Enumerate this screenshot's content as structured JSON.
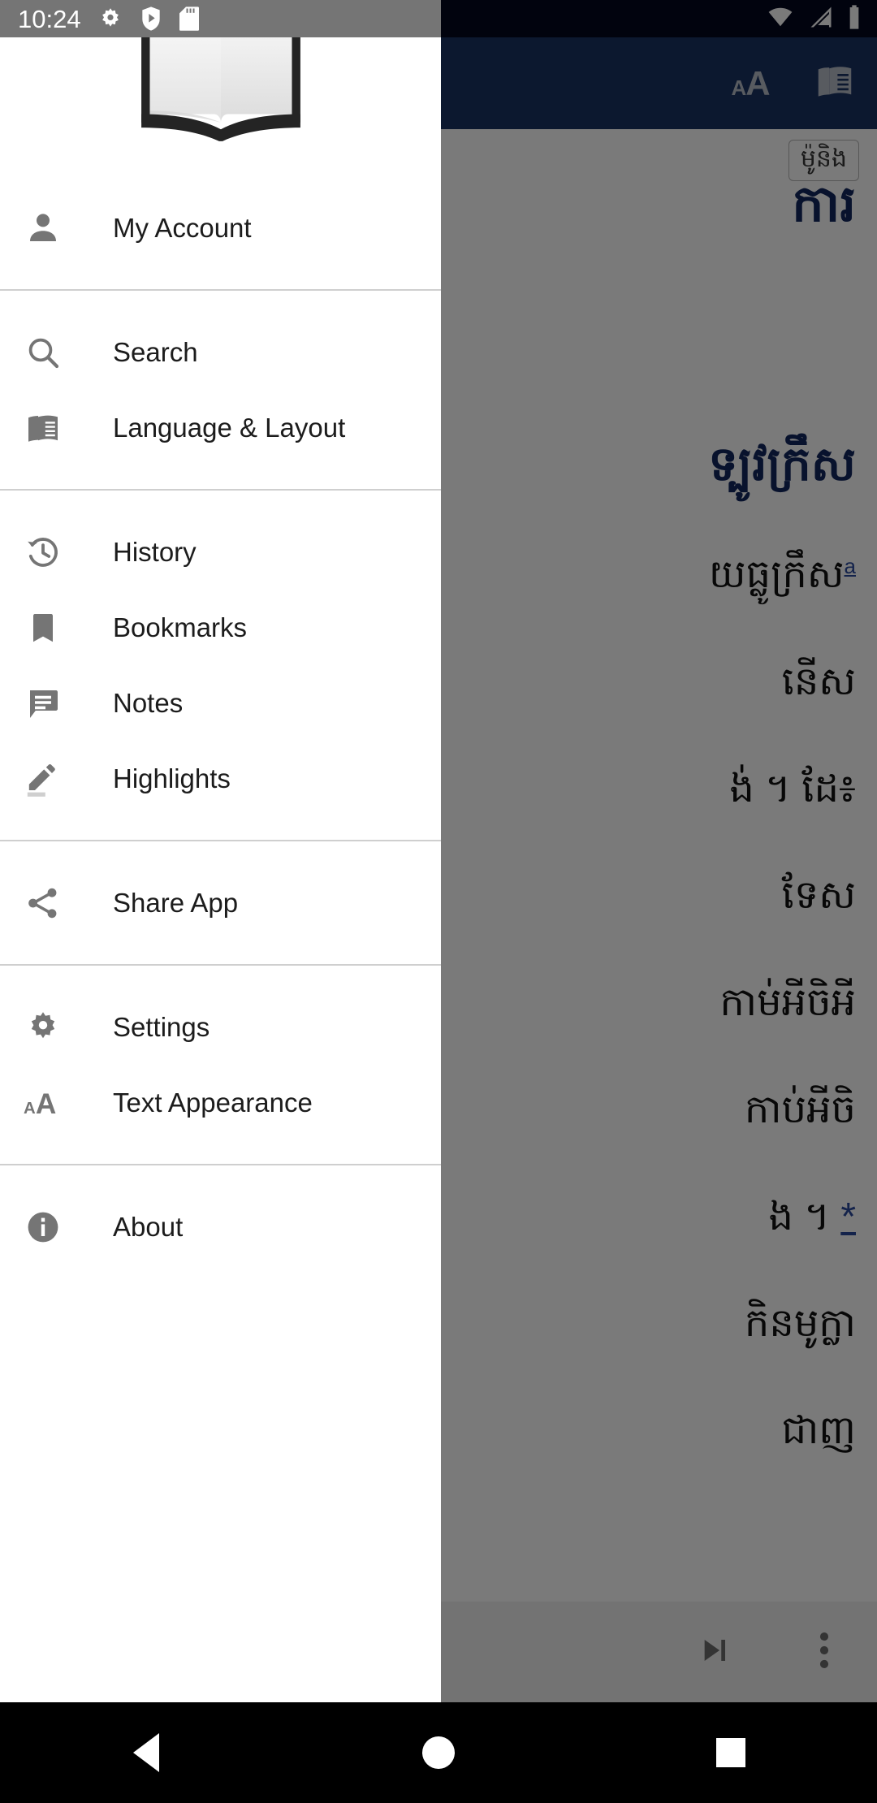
{
  "status_bar": {
    "time": "10:24",
    "left_icons": [
      "gear-icon",
      "play-protect-icon",
      "sd-card-icon"
    ],
    "right_icons": [
      "wifi-icon",
      "cellular-signal-icon",
      "battery-icon"
    ],
    "scrim_background": "#757575",
    "app_background": "#04071e"
  },
  "drawer": {
    "logo": "open-book-logo",
    "groups": [
      {
        "items": [
          {
            "label": "My Account",
            "icon": "person-icon"
          }
        ]
      },
      {
        "items": [
          {
            "label": "Search",
            "icon": "search-icon"
          },
          {
            "label": "Language & Layout",
            "icon": "menu-book-icon"
          }
        ]
      },
      {
        "items": [
          {
            "label": "History",
            "icon": "history-icon"
          },
          {
            "label": "Bookmarks",
            "icon": "bookmark-icon"
          },
          {
            "label": "Notes",
            "icon": "comment-lines-icon"
          },
          {
            "label": "Highlights",
            "icon": "pencil-underline-icon"
          }
        ]
      },
      {
        "items": [
          {
            "label": "Share App",
            "icon": "share-icon"
          }
        ]
      },
      {
        "items": [
          {
            "label": "Settings",
            "icon": "gear-icon"
          },
          {
            "label": "Text Appearance",
            "icon": "text-size-icon"
          }
        ]
      },
      {
        "items": [
          {
            "label": "About",
            "icon": "info-circle-icon"
          }
        ]
      }
    ]
  },
  "reader_app": {
    "toolbar": {
      "background": "#1a3263",
      "actions": [
        {
          "name": "text-appearance-button",
          "small": "A",
          "big": "A"
        },
        {
          "name": "language-layout-button",
          "icon": "menu-book-icon"
        }
      ]
    },
    "chip": {
      "label": "ម៉ូនិង"
    },
    "title": "ការ",
    "heading": "ទ្បូវក្រឹស",
    "body_lines": [
      {
        "text": "យធ្លូក្រឹស",
        "sup": "a"
      },
      {
        "text": "នើស"
      },
      {
        "text": "ង់ ។  ដែ៖"
      },
      {
        "text": "ទែស"
      },
      {
        "text": "កាម់អីចិអី"
      },
      {
        "text": "កាប់អីចិ"
      },
      {
        "text": "ង ។ ",
        "ast": "*"
      },
      {
        "text": "កិនមូក្លា"
      },
      {
        "text": "ជាញ"
      }
    ],
    "bottom_bar": {
      "actions": [
        {
          "name": "next-track-button",
          "icon": "skip-next-icon"
        },
        {
          "name": "overflow-menu-button",
          "icon": "more-vert-icon"
        }
      ]
    }
  },
  "nav_bar": {
    "buttons": [
      {
        "name": "back-button",
        "icon": "triangle-back-icon"
      },
      {
        "name": "home-button",
        "icon": "circle-home-icon"
      },
      {
        "name": "recents-button",
        "icon": "square-recents-icon"
      }
    ]
  }
}
